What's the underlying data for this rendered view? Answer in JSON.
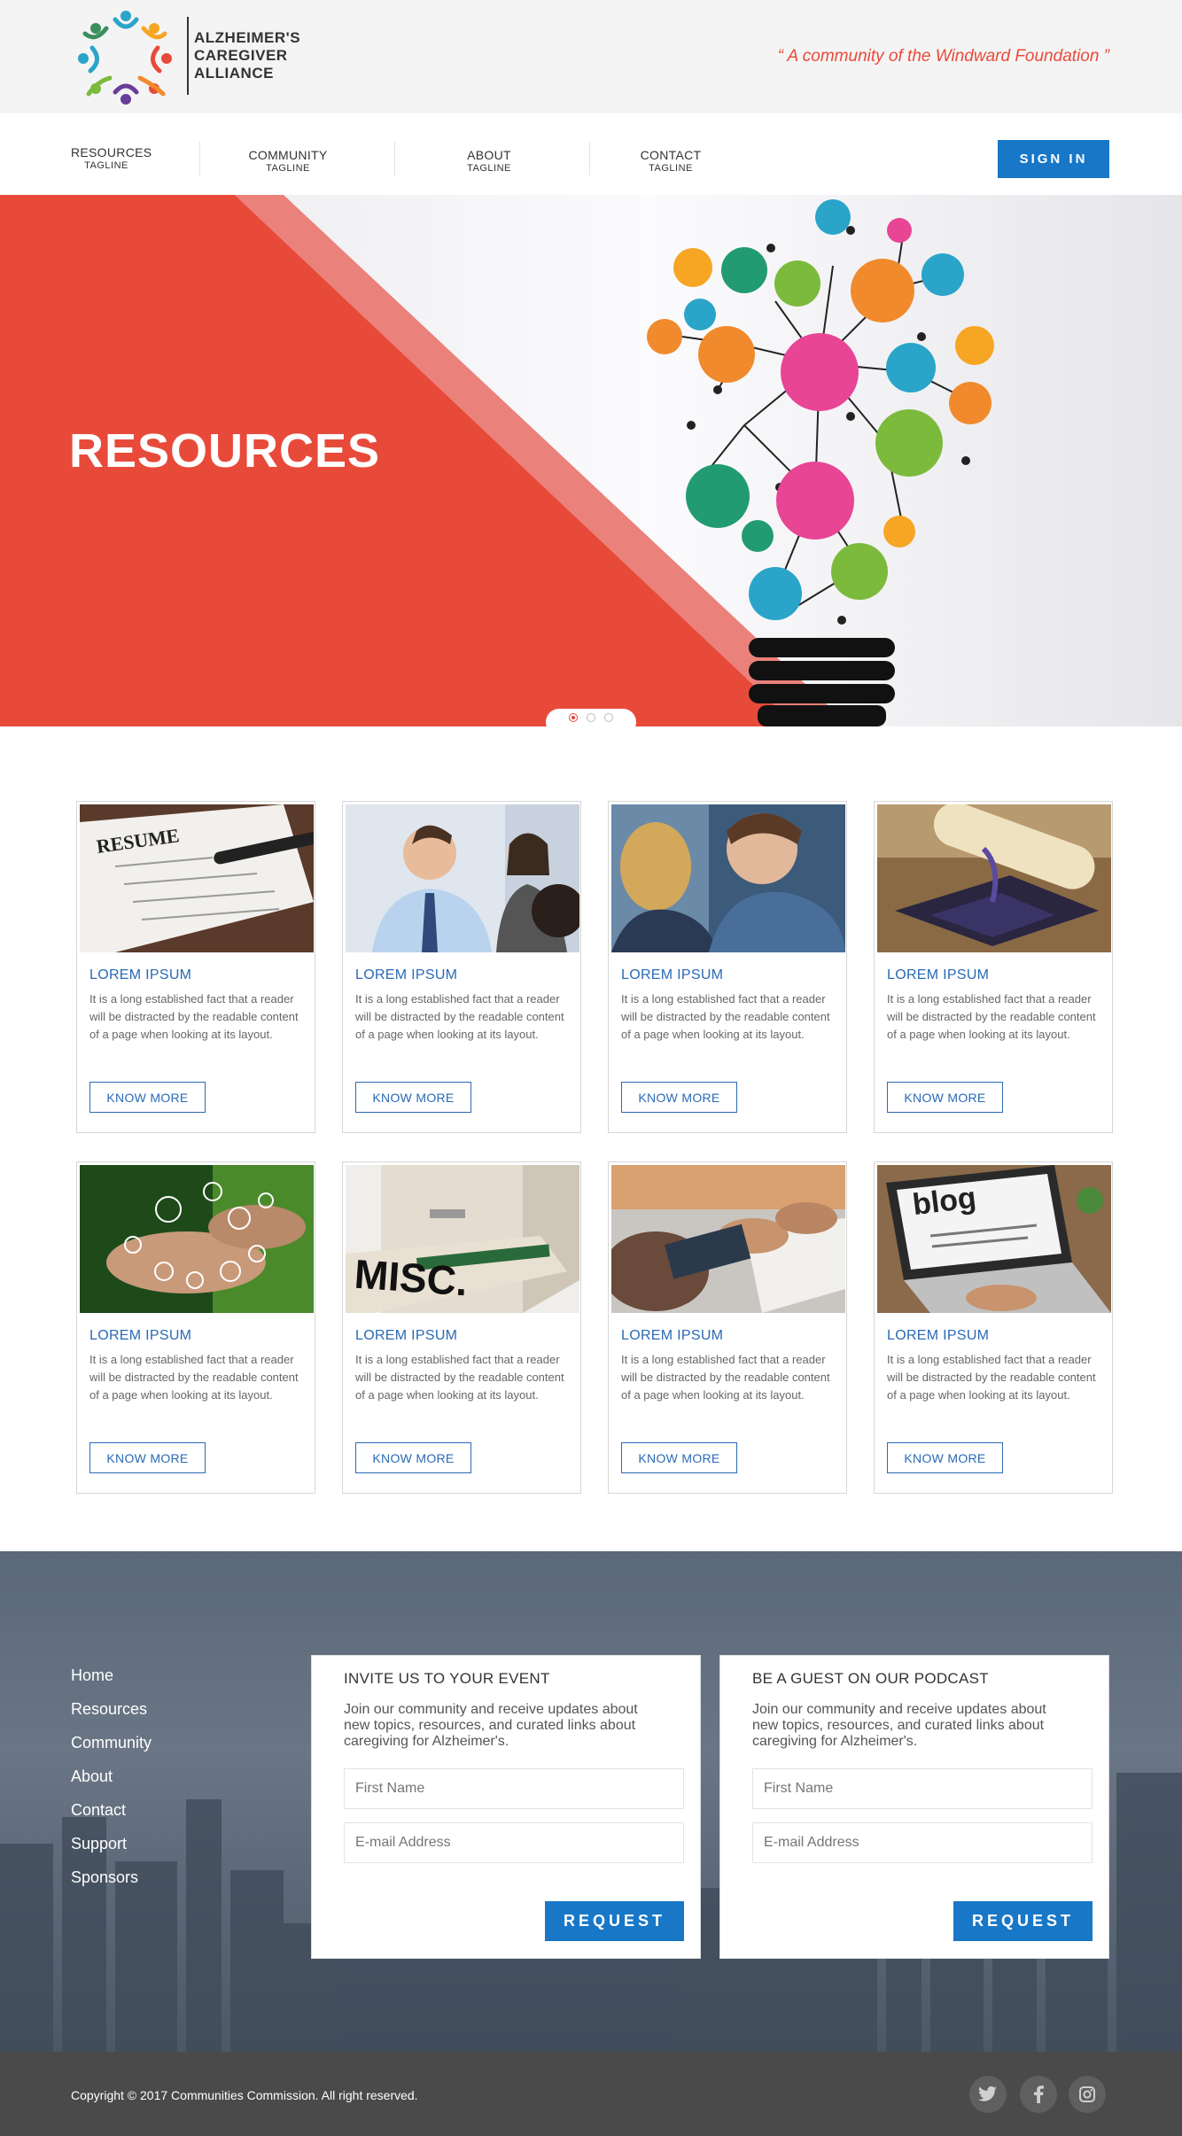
{
  "brand": {
    "logo_line1": "ALZHEIMER'S",
    "logo_line2": "CAREGIVER",
    "logo_line3": "ALLIANCE",
    "tagline": "“ A community of the Windward Foundation ”",
    "colors": {
      "accent_red": "#e84a3a",
      "primary_blue": "#1877c7",
      "link_blue": "#2a6ab5"
    }
  },
  "nav": {
    "items": [
      {
        "label": "RESOURCES",
        "sub": "TAGLINE"
      },
      {
        "label": "COMMUNITY",
        "sub": "TAGLINE"
      },
      {
        "label": "ABOUT",
        "sub": "TAGLINE"
      },
      {
        "label": "CONTACT",
        "sub": "TAGLINE"
      }
    ],
    "signin_label": "SIGN IN"
  },
  "hero": {
    "title": "RESOURCES",
    "illustration": "lightbulb-network-icon",
    "slides": 3,
    "active_slide": 1
  },
  "cards": [
    {
      "image": "resume-photo",
      "title": "LOREM IPSUM",
      "text": "It is a long established fact that a reader will be distracted by the readable content of a page when looking at its layout.",
      "button": "KNOW MORE"
    },
    {
      "image": "business-people-photo",
      "title": "LOREM IPSUM",
      "text": "It is a long established fact that a reader will be distracted by the readable content of a page when looking at its layout.",
      "button": "KNOW MORE"
    },
    {
      "image": "students-photo",
      "title": "LOREM IPSUM",
      "text": "It is a long established fact that a reader will be distracted by the readable content of a page when looking at its layout.",
      "button": "KNOW MORE"
    },
    {
      "image": "graduation-cap-photo",
      "title": "LOREM IPSUM",
      "text": "It is a long established fact that a reader will be distracted by the readable content of a page when looking at its layout.",
      "button": "KNOW MORE"
    },
    {
      "image": "network-hands-photo",
      "title": "LOREM IPSUM",
      "text": "It is a long established fact that a reader will be distracted by the readable content of a page when looking at its layout.",
      "button": "KNOW MORE"
    },
    {
      "image": "misc-cabinet-photo",
      "title": "LOREM IPSUM",
      "text": "It is a long established fact that a reader will be distracted by the readable content of a page when looking at its layout.",
      "button": "KNOW MORE",
      "image_label": "MISC."
    },
    {
      "image": "meeting-desk-photo",
      "title": "LOREM IPSUM",
      "text": "It is a long established fact that a reader will be distracted by the readable content of a page when looking at its layout.",
      "button": "KNOW MORE"
    },
    {
      "image": "blog-laptop-photo",
      "title": "LOREM IPSUM",
      "text": "It is a long established fact that a reader will be distracted by the readable content of a page when looking at its layout.",
      "button": "KNOW MORE",
      "image_label": "blog"
    }
  ],
  "footer": {
    "links": [
      "Home",
      "Resources",
      "Community",
      "About",
      "Contact",
      "Support",
      "Sponsors"
    ],
    "forms": [
      {
        "heading": "INVITE US TO YOUR EVENT",
        "text": "Join our community and receive updates about new topics, resources, and curated links about caregiving for Alzheimer's.",
        "name_placeholder": "First Name",
        "email_placeholder": "E-mail Address",
        "button": "REQUEST"
      },
      {
        "heading": "BE A GUEST ON OUR PODCAST",
        "text": "Join our community and receive updates about new topics, resources, and curated links about caregiving for Alzheimer's.",
        "name_placeholder": "First Name",
        "email_placeholder": "E-mail Address",
        "button": "REQUEST"
      }
    ],
    "copyright": "Copyright © 2017 Communities Commission. All right reserved.",
    "social": [
      "twitter-icon",
      "facebook-icon",
      "instagram-icon"
    ]
  }
}
